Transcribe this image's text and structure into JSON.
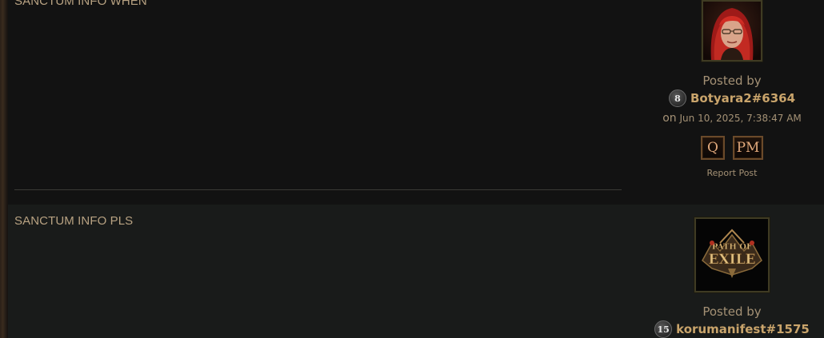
{
  "posts": [
    {
      "body": "SANCTUM INFO WHEN",
      "posted_by_label": "Posted by",
      "author": {
        "level": "8",
        "username": "Botyara2#6364"
      },
      "date_prefix": "on",
      "date": "Jun 10, 2025, 7:38:47 AM",
      "actions": {
        "quote": "Q",
        "pm": "PM"
      },
      "report": "Report Post"
    },
    {
      "body": "SANCTUM INFO PLS",
      "posted_by_label": "Posted by",
      "author": {
        "level": "15",
        "username": "korumanifest#1575"
      },
      "avatar_logo": "PATH OF EXILE"
    }
  ],
  "colors": {
    "accent": "#c9a46b",
    "text": "#b8a282",
    "button_border": "#6b4a2a"
  },
  "icons": [
    "level-badge-icon",
    "quote-icon",
    "pm-icon"
  ]
}
